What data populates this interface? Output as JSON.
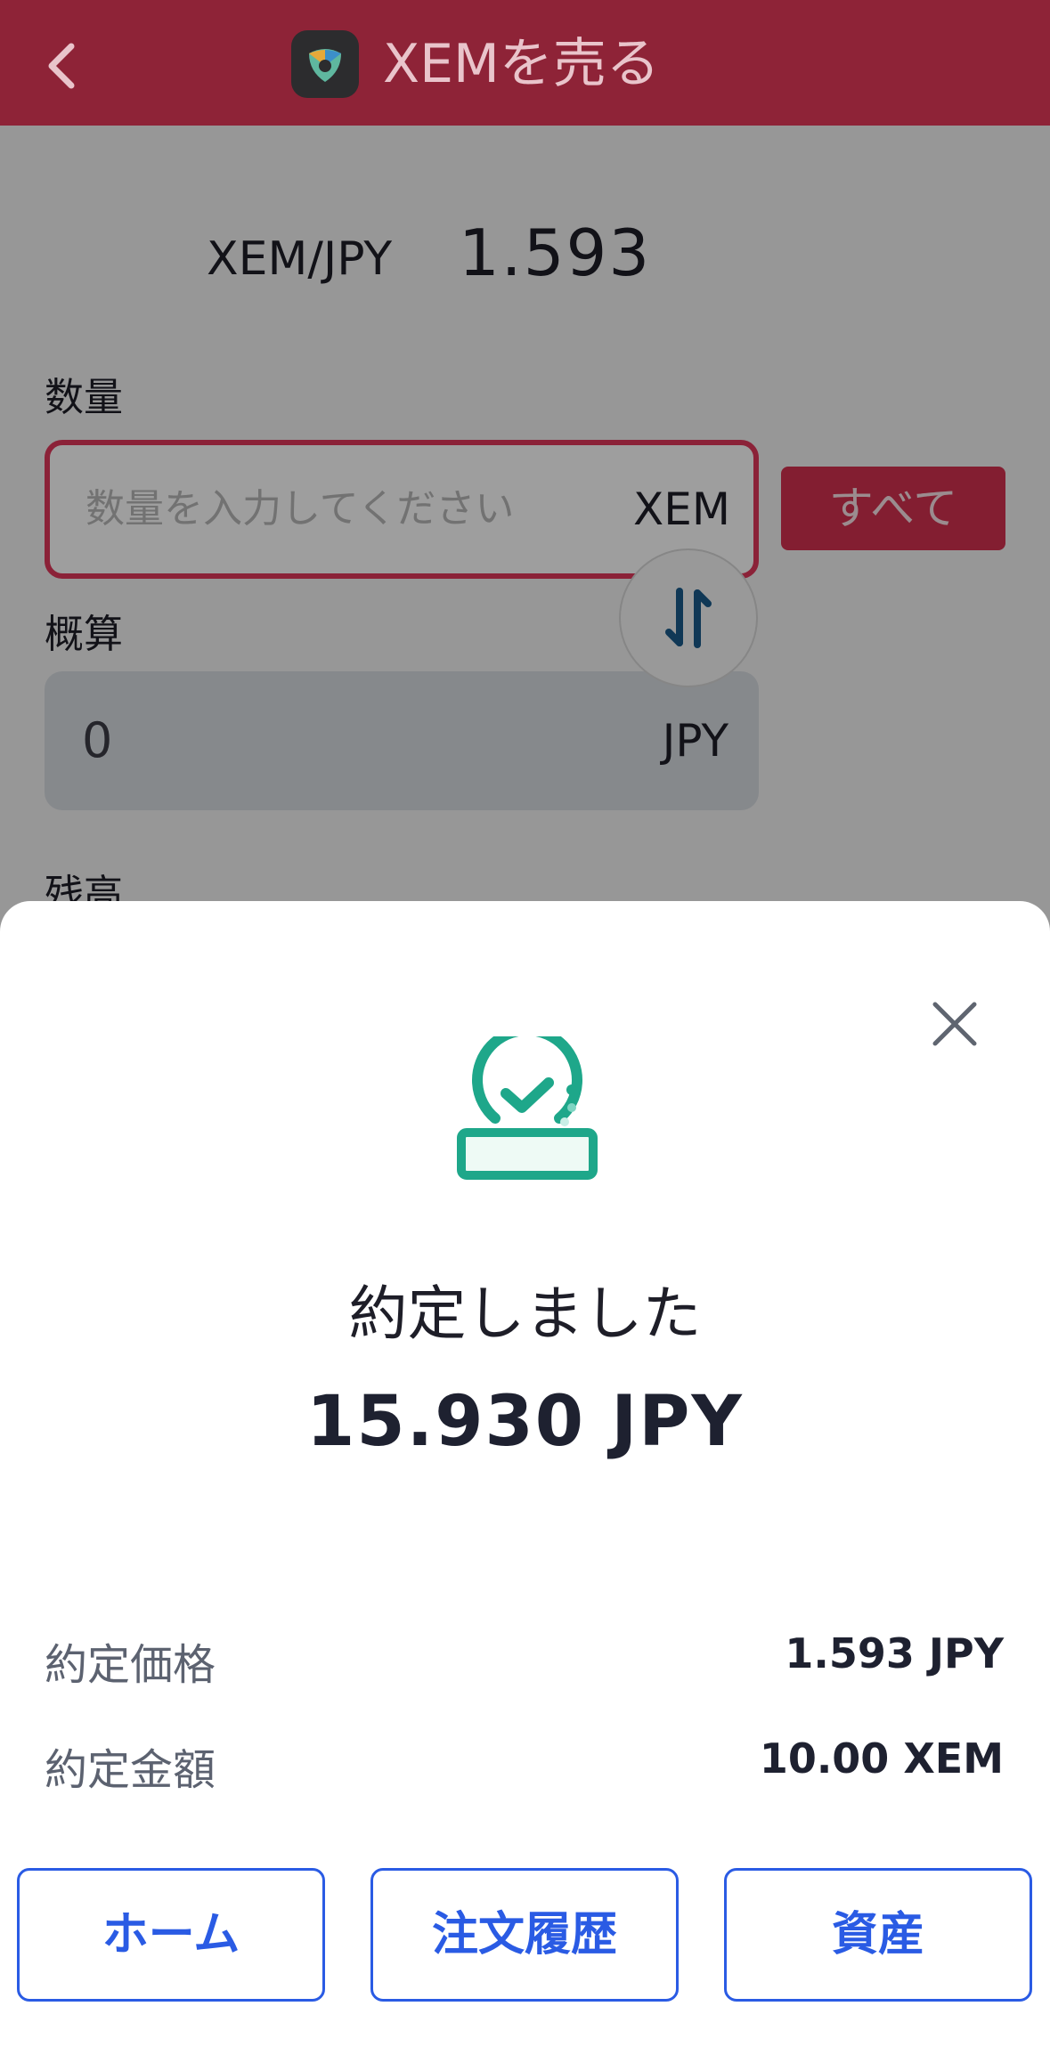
{
  "header": {
    "title": "XEMを売る",
    "back_icon": "chevron-left-icon",
    "logo_icon": "nem-logo-icon",
    "color": "#8e2337"
  },
  "form": {
    "pair": "XEM/JPY",
    "price": "1.593",
    "quantity_label": "数量",
    "quantity_placeholder": "数量を入力してください",
    "quantity_unit": "XEM",
    "all_button": "すべて",
    "estimate_label": "概算",
    "estimate_value": "0",
    "estimate_unit": "JPY",
    "balance_label": "残高"
  },
  "result": {
    "title": "約定しました",
    "amount": "15.930 JPY",
    "icon": "stamp-check-icon",
    "accent": "#1ea78a",
    "details": [
      {
        "label": "約定価格",
        "value": "1.593 JPY"
      },
      {
        "label": "約定金額",
        "value": "10.00 XEM"
      }
    ]
  },
  "actions": {
    "home": "ホーム",
    "order_history": "注文履歴",
    "assets": "資産",
    "color": "#2a5be4"
  }
}
